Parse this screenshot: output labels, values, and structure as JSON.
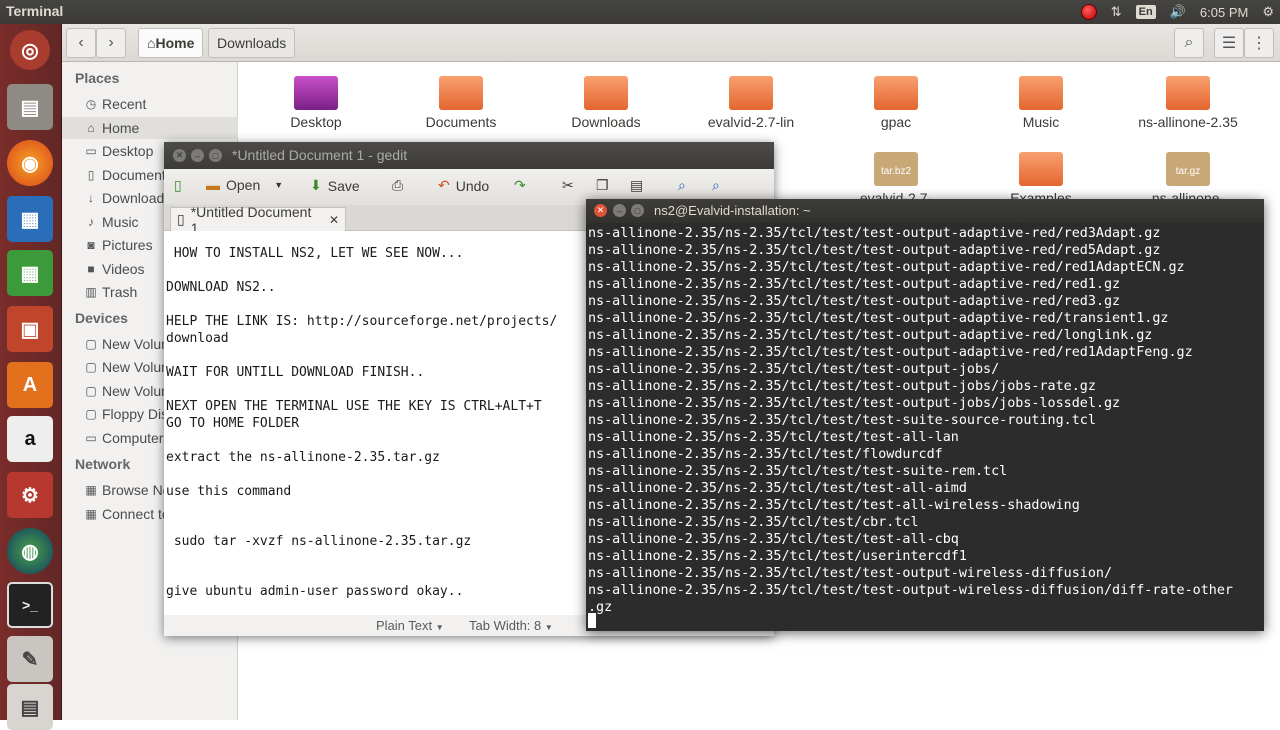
{
  "topbar": {
    "app_title": "Terminal",
    "kbd": "En",
    "time": "6:05 PM"
  },
  "files": {
    "breadcrumb": {
      "home": "Home",
      "current": "Downloads"
    },
    "sidebar": {
      "places_header": "Places",
      "places": [
        "Recent",
        "Home",
        "Desktop",
        "Documents",
        "Downloads",
        "Music",
        "Pictures",
        "Videos",
        "Trash"
      ],
      "devices_header": "Devices",
      "devices": [
        "New Volume",
        "New Volume",
        "New Volume",
        "Floppy Disk",
        "Computer"
      ],
      "network_header": "Network",
      "network": [
        "Browse Network",
        "Connect to Server"
      ]
    },
    "items_row1": [
      "Desktop",
      "Documents",
      "Downloads",
      "evalvid-2.7-lin",
      "gpac",
      "Music",
      "ns-allinone-2.35"
    ],
    "items_row2": [
      "evalvid-2.7-lin.tar.bz2",
      "Examples",
      "ns-allinone-2.35.tar.gz"
    ],
    "badges": {
      "bz2": "tar.bz2",
      "gz": "tar.gz"
    }
  },
  "gedit": {
    "title": "*Untitled Document 1 - gedit",
    "toolbar": {
      "open": "Open",
      "save": "Save",
      "undo": "Undo"
    },
    "tab_label": "*Untitled Document 1",
    "lines": [
      " HOW TO INSTALL NS2, LET WE SEE NOW...",
      "DOWNLOAD NS2..",
      "HELP THE LINK IS: http://sourceforge.net/projects/",
      "download",
      "WAIT FOR UNTILL DOWNLOAD FINISH..",
      "NEXT OPEN THE TERMINAL USE THE KEY IS CTRL+ALT+T",
      "GO TO HOME FOLDER",
      "extract the ns-allinone-2.35.tar.gz",
      "use this command",
      " sudo tar -xvzf ns-allinone-2.35.tar.gz",
      "give ubuntu admin-user password okay.."
    ],
    "status": {
      "mode": "Plain Text",
      "tab_width": "Tab Width: 8"
    }
  },
  "terminal": {
    "title": "ns2@Evalvid-installation: ~",
    "lines": [
      "ns-allinone-2.35/ns-2.35/tcl/test/test-output-adaptive-red/red3Adapt.gz",
      "ns-allinone-2.35/ns-2.35/tcl/test/test-output-adaptive-red/red5Adapt.gz",
      "ns-allinone-2.35/ns-2.35/tcl/test/test-output-adaptive-red/red1AdaptECN.gz",
      "ns-allinone-2.35/ns-2.35/tcl/test/test-output-adaptive-red/red1.gz",
      "ns-allinone-2.35/ns-2.35/tcl/test/test-output-adaptive-red/red3.gz",
      "ns-allinone-2.35/ns-2.35/tcl/test/test-output-adaptive-red/transient1.gz",
      "ns-allinone-2.35/ns-2.35/tcl/test/test-output-adaptive-red/longlink.gz",
      "ns-allinone-2.35/ns-2.35/tcl/test/test-output-adaptive-red/red1AdaptFeng.gz",
      "ns-allinone-2.35/ns-2.35/tcl/test/test-output-jobs/",
      "ns-allinone-2.35/ns-2.35/tcl/test/test-output-jobs/jobs-rate.gz",
      "ns-allinone-2.35/ns-2.35/tcl/test/test-output-jobs/jobs-lossdel.gz",
      "ns-allinone-2.35/ns-2.35/tcl/test/test-suite-source-routing.tcl",
      "ns-allinone-2.35/ns-2.35/tcl/test/test-all-lan",
      "ns-allinone-2.35/ns-2.35/tcl/test/flowdurcdf",
      "ns-allinone-2.35/ns-2.35/tcl/test/test-suite-rem.tcl",
      "ns-allinone-2.35/ns-2.35/tcl/test/test-all-aimd",
      "ns-allinone-2.35/ns-2.35/tcl/test/test-all-wireless-shadowing",
      "ns-allinone-2.35/ns-2.35/tcl/test/cbr.tcl",
      "ns-allinone-2.35/ns-2.35/tcl/test/test-all-cbq",
      "ns-allinone-2.35/ns-2.35/tcl/test/userintercdf1",
      "ns-allinone-2.35/ns-2.35/tcl/test/test-output-wireless-diffusion/",
      "ns-allinone-2.35/ns-2.35/tcl/test/test-output-wireless-diffusion/diff-rate-other",
      ".gz"
    ]
  },
  "colors": {
    "launcher": "#6b2928",
    "terminal_bg": "#2c2c2c",
    "folder": "#f0773c",
    "topbar": "#3c3b37"
  }
}
